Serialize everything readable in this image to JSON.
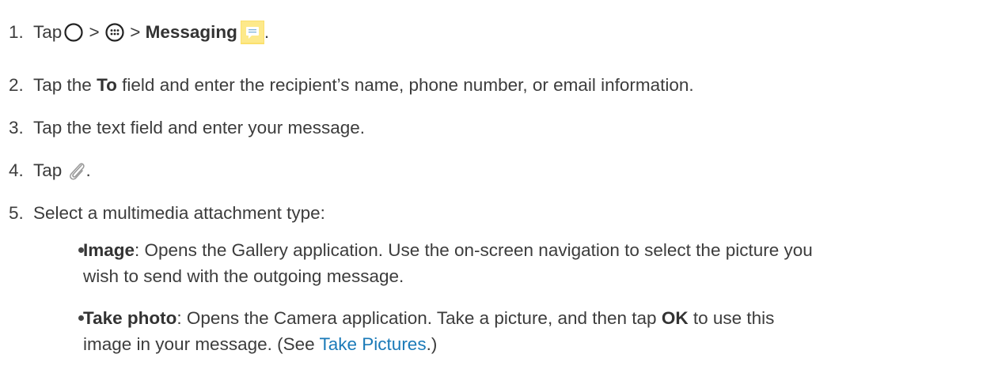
{
  "steps": [
    {
      "number": "1.",
      "tap": "Tap",
      "sep1": ">",
      "sep2": ">",
      "app": "Messaging",
      "end": ".",
      "icons": [
        "home-circle-icon",
        "apps-grid-icon",
        "messaging-app-icon"
      ]
    },
    {
      "number": "2.",
      "pre": "Tap the",
      "bold": "To",
      "post": "field and enter the recipient’s name, phone number, or email information."
    },
    {
      "number": "3.",
      "text": "Tap the text field and enter your message."
    },
    {
      "number": "4.",
      "tap": "Tap",
      "end": ".",
      "icons": [
        "paperclip-icon"
      ]
    },
    {
      "number": "5.",
      "text": "Select a multimedia attachment type:"
    }
  ],
  "bullets": [
    {
      "term": "Image",
      "line1": ": Opens the Gallery application. Use the on-screen navigation to select the picture you",
      "line2": "wish to send with the outgoing message."
    },
    {
      "term": "Take photo",
      "line1a": ": Opens the Camera application. Take a picture, and then tap",
      "ok": "OK",
      "line1b": "to use this",
      "line2a": "image in your message. (See",
      "link": "Take Pictures",
      "line2b": ".)"
    }
  ],
  "colors": {
    "text": "#3c3c3c",
    "link": "#1a7ab8",
    "messaging_icon_bg": "#fde98a"
  }
}
